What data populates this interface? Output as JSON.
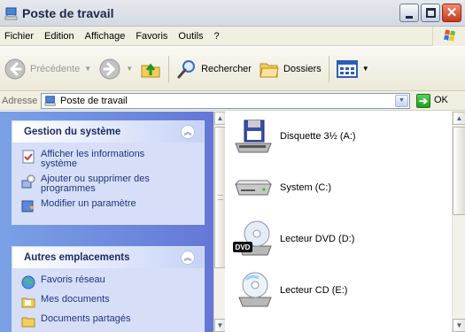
{
  "window": {
    "title": "Poste de travail"
  },
  "menubar": {
    "items": [
      "Fichier",
      "Edition",
      "Affichage",
      "Favoris",
      "Outils",
      "?"
    ]
  },
  "toolbar": {
    "back_label": "Précédente",
    "search_label": "Rechercher",
    "folders_label": "Dossiers"
  },
  "address": {
    "label": "Adresse",
    "value": "Poste de travail",
    "go_label": "OK"
  },
  "taskpane": {
    "system_tasks": {
      "title": "Gestion du système",
      "items": [
        {
          "label": "Afficher les informations",
          "label2": "système"
        },
        {
          "label": "Ajouter ou supprimer des",
          "label2": "programmes"
        },
        {
          "label": "Modifier un paramètre",
          "label2": ""
        }
      ]
    },
    "other_places": {
      "title": "Autres emplacements",
      "items": [
        {
          "label": "Favoris réseau"
        },
        {
          "label": "Mes documents"
        },
        {
          "label": "Documents partagés"
        }
      ]
    }
  },
  "drives": [
    {
      "label": "Disquette 3½ (A:)",
      "icon": "floppy-drive-icon"
    },
    {
      "label": "System (C:)",
      "icon": "hard-disk-icon"
    },
    {
      "label": "Lecteur DVD (D:)",
      "icon": "dvd-drive-icon"
    },
    {
      "label": "Lecteur CD (E:)",
      "icon": "cd-drive-icon"
    }
  ],
  "colors": {
    "taskpane_bg": "#7aa1e6",
    "panel_body": "#d6dff7",
    "task_link": "#21347d",
    "close_button": "#c7391b"
  }
}
